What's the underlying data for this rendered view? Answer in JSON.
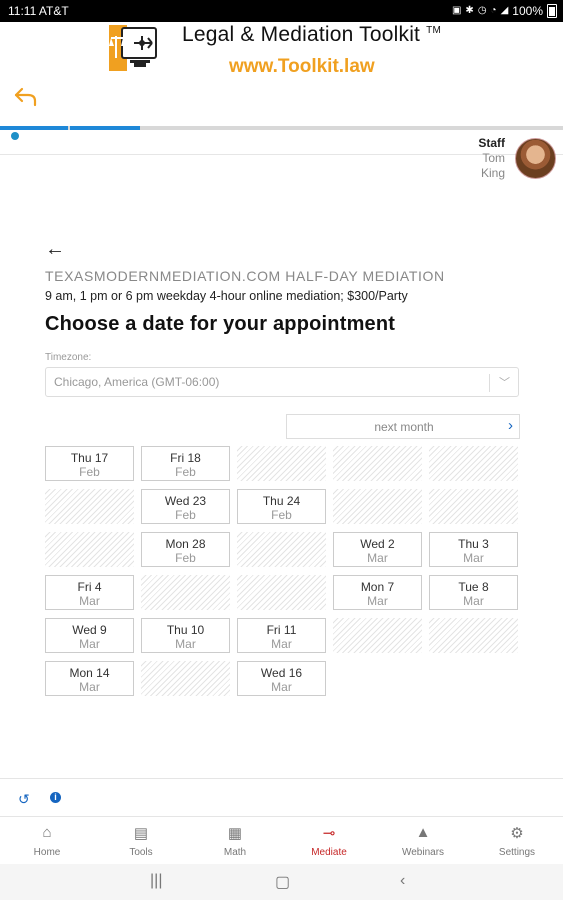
{
  "status_bar": {
    "time": "11:11 AT&T",
    "battery": "100%"
  },
  "header": {
    "title": "Legal & Mediation Toolkit",
    "trademark": "TM",
    "url": "www.Toolkit.law"
  },
  "progress_colors": {
    "active": "#1e88d8",
    "inactive": "#d8d8d8"
  },
  "staff": {
    "label": "Staff",
    "first_name": "Tom",
    "last_name": "King"
  },
  "booking": {
    "step_back": "←",
    "service": "TEXASMODERNMEDIATION.COM HALF-DAY MEDIATION",
    "description": "9 am, 1 pm or 6 pm weekday 4-hour online mediation; $300/Party",
    "heading": "Choose a date for your appointment",
    "timezone_label": "Timezone:",
    "timezone_value": "Chicago, America (GMT-06:00)",
    "next_month": "next month"
  },
  "calendar": {
    "rows": [
      [
        {
          "day": "Thu 17",
          "month": "Feb"
        },
        {
          "day": "Fri 18",
          "month": "Feb"
        },
        null,
        null,
        null
      ],
      [
        null,
        {
          "day": "Wed 23",
          "month": "Feb"
        },
        {
          "day": "Thu 24",
          "month": "Feb"
        },
        null,
        null
      ],
      [
        null,
        {
          "day": "Mon 28",
          "month": "Feb"
        },
        null,
        {
          "day": "Wed 2",
          "month": "Mar"
        },
        {
          "day": "Thu 3",
          "month": "Mar"
        }
      ],
      [
        {
          "day": "Fri 4",
          "month": "Mar"
        },
        null,
        null,
        {
          "day": "Mon 7",
          "month": "Mar"
        },
        {
          "day": "Tue 8",
          "month": "Mar"
        }
      ],
      [
        {
          "day": "Wed 9",
          "month": "Mar"
        },
        {
          "day": "Thu 10",
          "month": "Mar"
        },
        {
          "day": "Fri 11",
          "month": "Mar"
        },
        null,
        null
      ],
      [
        {
          "day": "Mon 14",
          "month": "Mar"
        },
        null,
        {
          "day": "Wed 16",
          "month": "Mar"
        },
        "empty",
        "empty"
      ]
    ]
  },
  "tabs": [
    {
      "label": "Home",
      "icon": "home-icon",
      "glyph": "⌂"
    },
    {
      "label": "Tools",
      "icon": "toolbox-icon",
      "glyph": "▤"
    },
    {
      "label": "Math",
      "icon": "calculator-icon",
      "glyph": "▦"
    },
    {
      "label": "Mediate",
      "icon": "mediate-icon",
      "glyph": "⊸"
    },
    {
      "label": "Webinars",
      "icon": "graduation-cap-icon",
      "glyph": "▲"
    },
    {
      "label": "Settings",
      "icon": "gear-icon",
      "glyph": "⚙"
    }
  ],
  "active_tab": "Mediate",
  "accent_color": "#c62828"
}
